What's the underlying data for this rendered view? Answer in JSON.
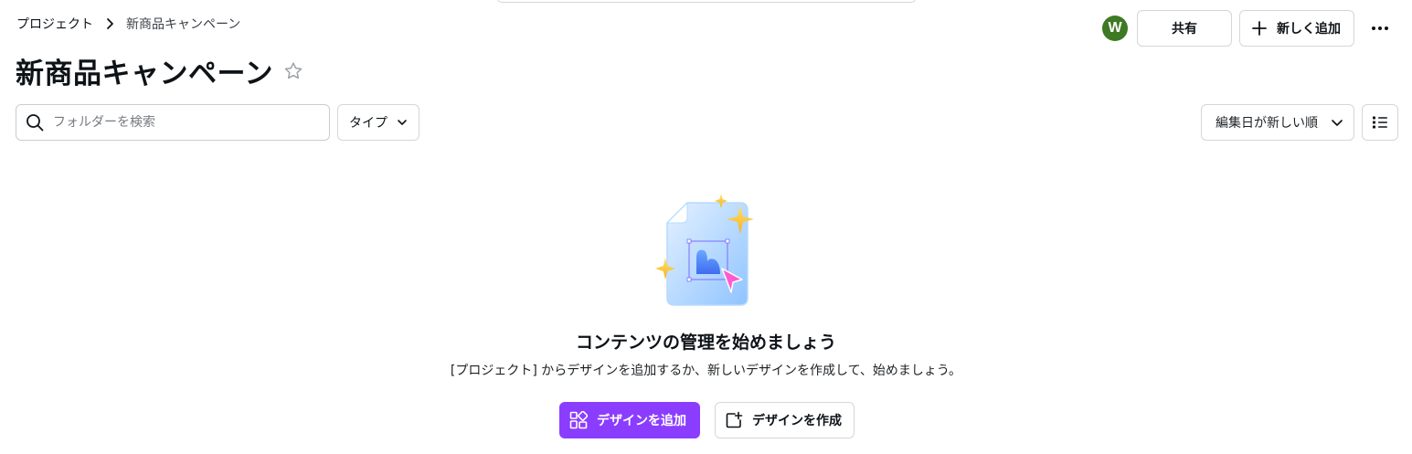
{
  "breadcrumb": {
    "root": "プロジェクト",
    "current": "新商品キャンペーン"
  },
  "header": {
    "avatar_initial": "W",
    "share_label": "共有",
    "add_new_label": "新しく追加"
  },
  "page": {
    "title": "新商品キャンペーン"
  },
  "toolbar": {
    "search_placeholder": "フォルダーを検索",
    "type_filter_label": "タイプ",
    "sort_label": "編集日が新しい順"
  },
  "empty_state": {
    "title": "コンテンツの管理を始めましょう",
    "description": "[プロジェクト] からデザインを追加するか、新しいデザインを作成して、始めましょう。",
    "add_design_label": "デザインを追加",
    "create_design_label": "デザインを作成"
  },
  "icons": [
    "chevron-right-icon",
    "plus-icon",
    "more-icon",
    "star-icon",
    "search-icon",
    "chevron-down-icon",
    "list-view-icon",
    "add-design-icon",
    "create-design-icon"
  ],
  "colors": {
    "primary": "#8b3dff",
    "avatar": "#3d7a23",
    "border": "#d4d6da"
  }
}
